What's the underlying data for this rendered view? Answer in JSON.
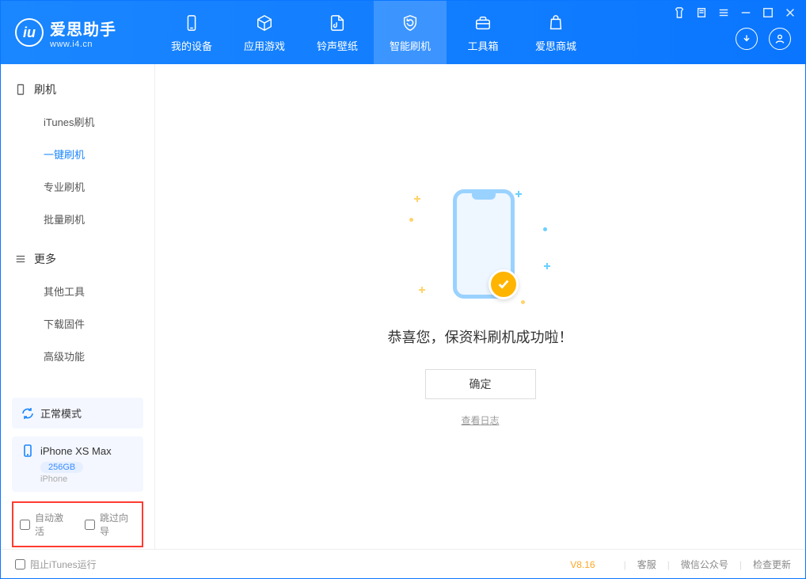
{
  "app": {
    "name": "爱思助手",
    "site": "www.i4.cn"
  },
  "tabs": [
    {
      "label": "我的设备"
    },
    {
      "label": "应用游戏"
    },
    {
      "label": "铃声壁纸"
    },
    {
      "label": "智能刷机"
    },
    {
      "label": "工具箱"
    },
    {
      "label": "爱思商城"
    }
  ],
  "sidebar": {
    "g1": {
      "title": "刷机",
      "items": [
        "iTunes刷机",
        "一键刷机",
        "专业刷机",
        "批量刷机"
      ]
    },
    "g2": {
      "title": "更多",
      "items": [
        "其他工具",
        "下载固件",
        "高级功能"
      ]
    }
  },
  "status": {
    "mode": "正常模式",
    "device": "iPhone XS Max",
    "capacity": "256GB",
    "platform": "iPhone"
  },
  "options": {
    "auto_activate": "自动激活",
    "skip_guide": "跳过向导"
  },
  "main": {
    "message": "恭喜您，保资料刷机成功啦！",
    "confirm": "确定",
    "view_log": "查看日志"
  },
  "footer": {
    "block_itunes": "阻止iTunes运行",
    "version": "V8.16",
    "links": [
      "客服",
      "微信公众号",
      "检查更新"
    ]
  }
}
